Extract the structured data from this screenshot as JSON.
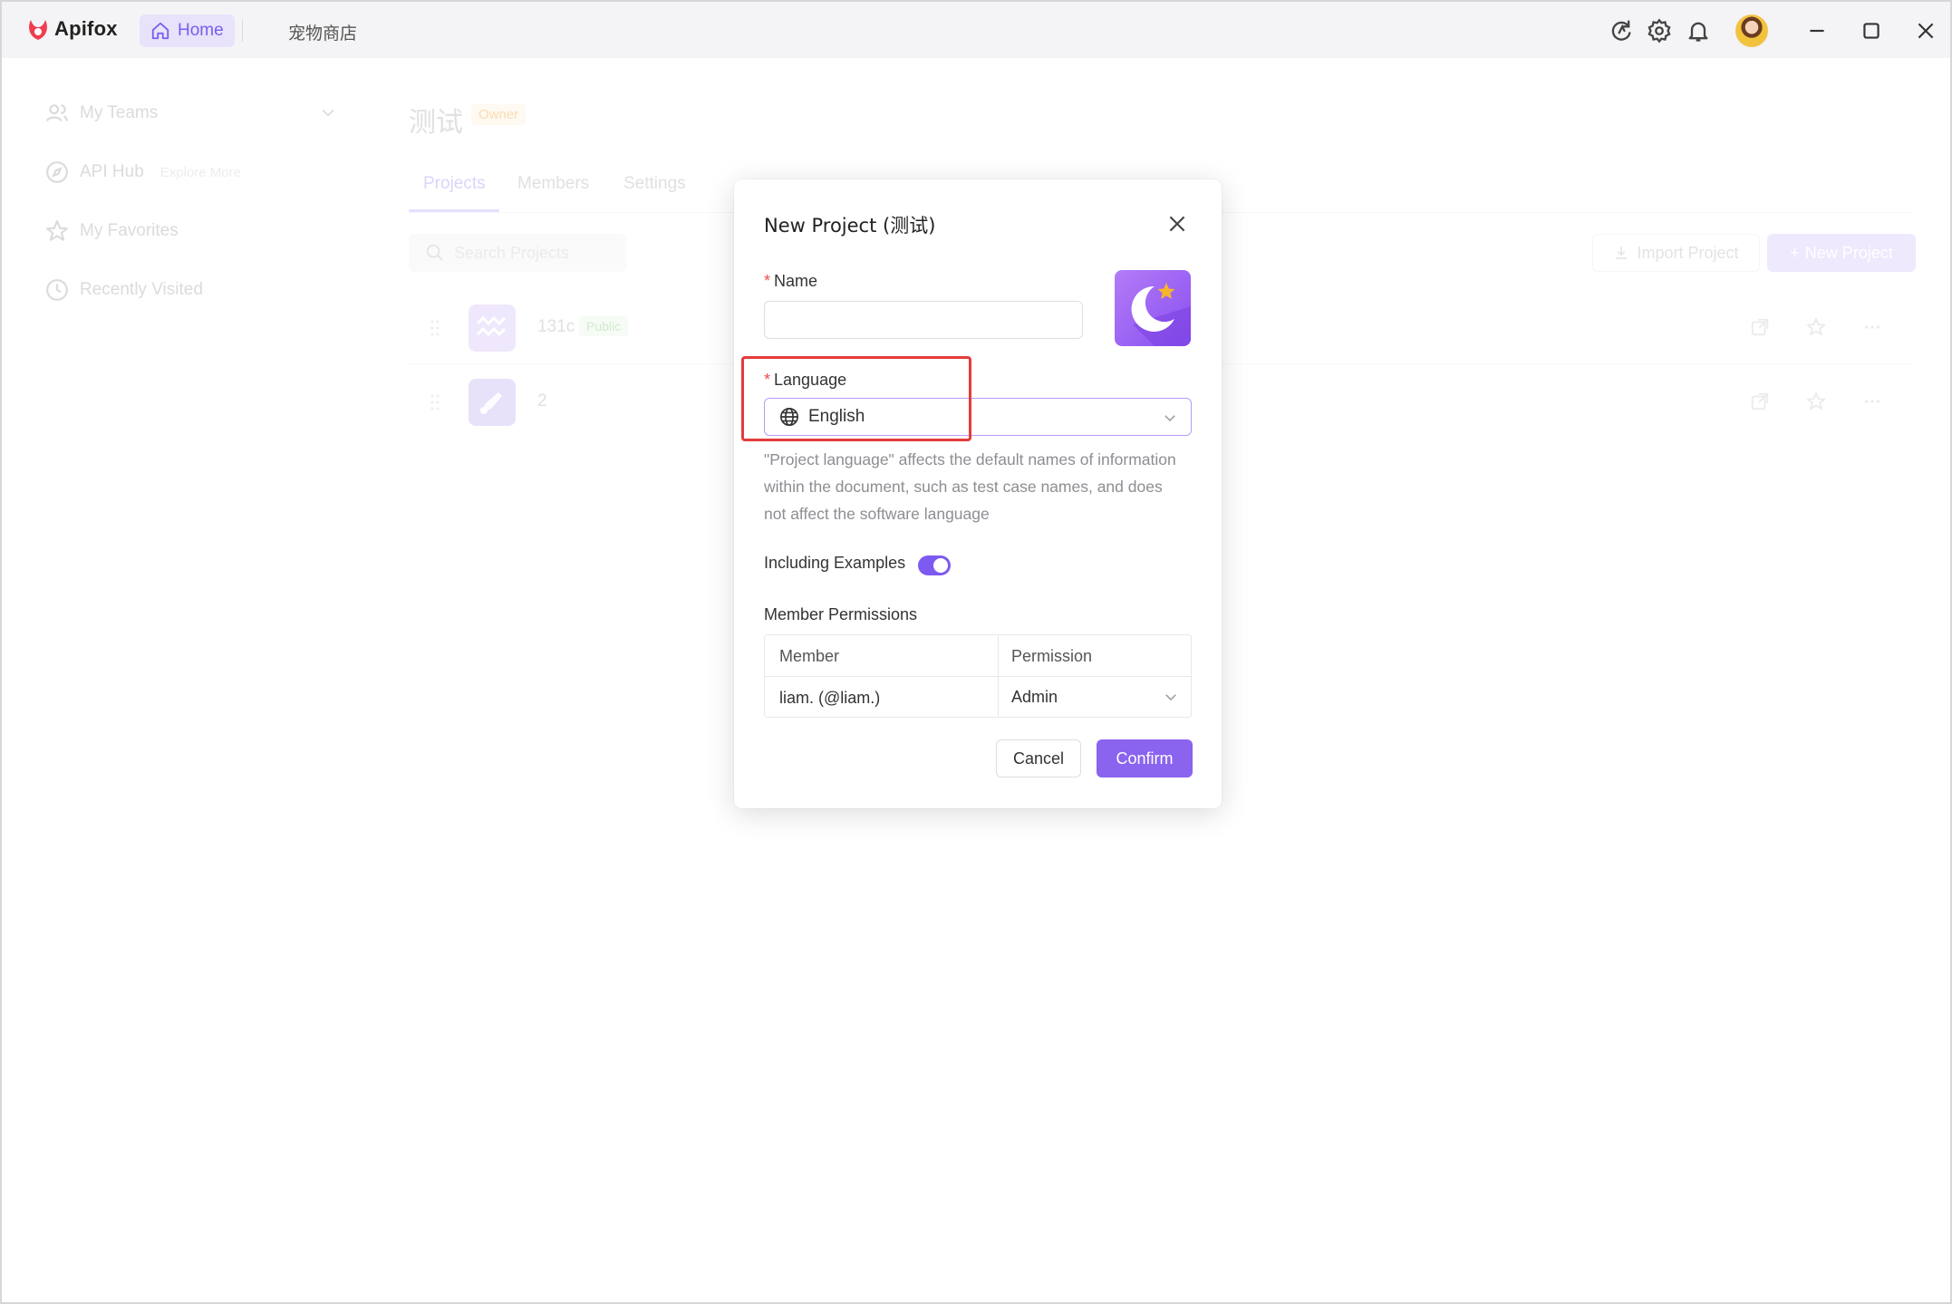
{
  "app": {
    "name": "Apifox"
  },
  "titlebar": {
    "home_tab": "Home",
    "shop_tab": "宠物商店",
    "icons": [
      "refresh-icon",
      "gear-icon",
      "bell-icon",
      "avatar",
      "minimize-icon",
      "maximize-icon",
      "close-icon"
    ]
  },
  "sidebar": {
    "items": [
      {
        "label": "My Teams",
        "icon": "team-icon"
      },
      {
        "label": "API Hub",
        "icon": "compass-icon",
        "extra": "Explore More"
      },
      {
        "label": "My Favorites",
        "icon": "star-icon"
      },
      {
        "label": "Recently Visited",
        "icon": "clock-icon"
      }
    ]
  },
  "main": {
    "team_name": "测试",
    "role_badge": "Owner",
    "tabs": [
      "Projects",
      "Members",
      "Settings"
    ],
    "active_tab": "Projects",
    "search_placeholder": "Search Projects",
    "import_label": "Import Project",
    "new_label": "New Project",
    "projects": [
      {
        "name": "131c",
        "badge": "Public"
      },
      {
        "name": "2",
        "badge": ""
      }
    ]
  },
  "modal": {
    "title": "New Project (测试)",
    "name_label": "Name",
    "name_value": "",
    "required_mark": "*",
    "language_label": "Language",
    "language_value": "English",
    "language_hint": "\"Project language\" affects the default names of information within the document, such as test case names, and does not affect the software language",
    "examples_label": "Including Examples",
    "examples_enabled": true,
    "permissions_label": "Member Permissions",
    "table": {
      "headers": [
        "Member",
        "Permission"
      ],
      "rows": [
        {
          "member": "liam. (@liam.)",
          "permission": "Admin"
        }
      ]
    },
    "cancel_label": "Cancel",
    "confirm_label": "Confirm"
  },
  "colors": {
    "accent": "#8a63ef",
    "highlight": "#e43b3b",
    "required": "#f04a4a"
  }
}
